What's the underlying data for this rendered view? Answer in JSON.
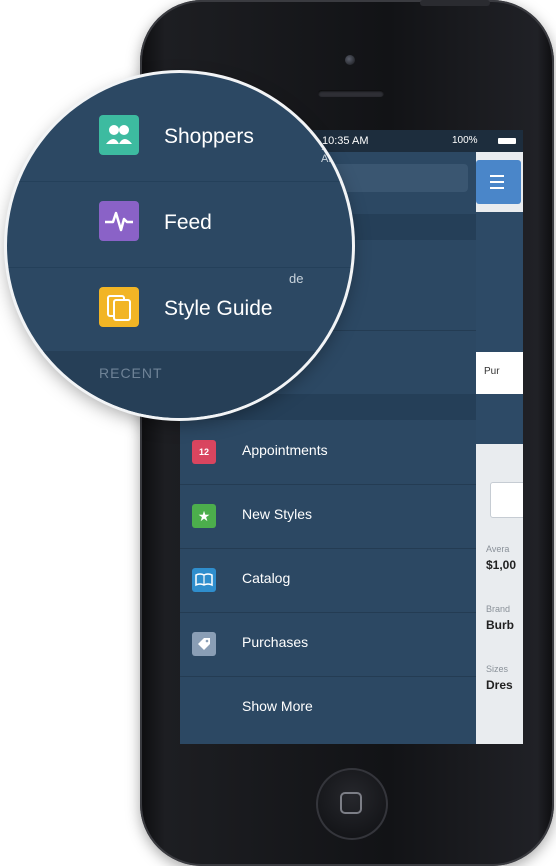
{
  "status": {
    "time": "10:35 AM",
    "battery": "100%"
  },
  "magnifier": {
    "items": [
      {
        "label": "Shoppers",
        "icon": "shoppers-icon",
        "color": "#3dbba0"
      },
      {
        "label": "Feed",
        "icon": "feed-icon",
        "color": "#8a62c7"
      },
      {
        "label": "Style Guide",
        "icon": "style-guide-icon",
        "color": "#f2b525"
      }
    ],
    "recent_label": "RECENT",
    "style_guide_fragment": "de"
  },
  "menu": {
    "items": [
      {
        "label": "Appointments",
        "icon": "calendar-icon",
        "color": "#d9455f",
        "glyph": "12"
      },
      {
        "label": "New Styles",
        "icon": "star-icon",
        "color": "#4cae4c",
        "glyph": "★"
      },
      {
        "label": "Catalog",
        "icon": "book-icon",
        "color": "#2f8ecd",
        "glyph": "📖"
      },
      {
        "label": "Purchases",
        "icon": "tag-icon",
        "color": "#8a9eb5",
        "glyph": "◈"
      },
      {
        "label": "Show More",
        "icon": "",
        "color": "",
        "glyph": ""
      }
    ]
  },
  "right_panel": {
    "tab": "Pur",
    "fields": [
      {
        "label": "Avera",
        "value": "$1,00"
      },
      {
        "label": "Brand",
        "value": "Burb"
      },
      {
        "label": "Sizes",
        "value": "Dres"
      }
    ]
  },
  "colors": {
    "menu_bg": "#2c4863",
    "accent_blue": "#4a86c9"
  }
}
